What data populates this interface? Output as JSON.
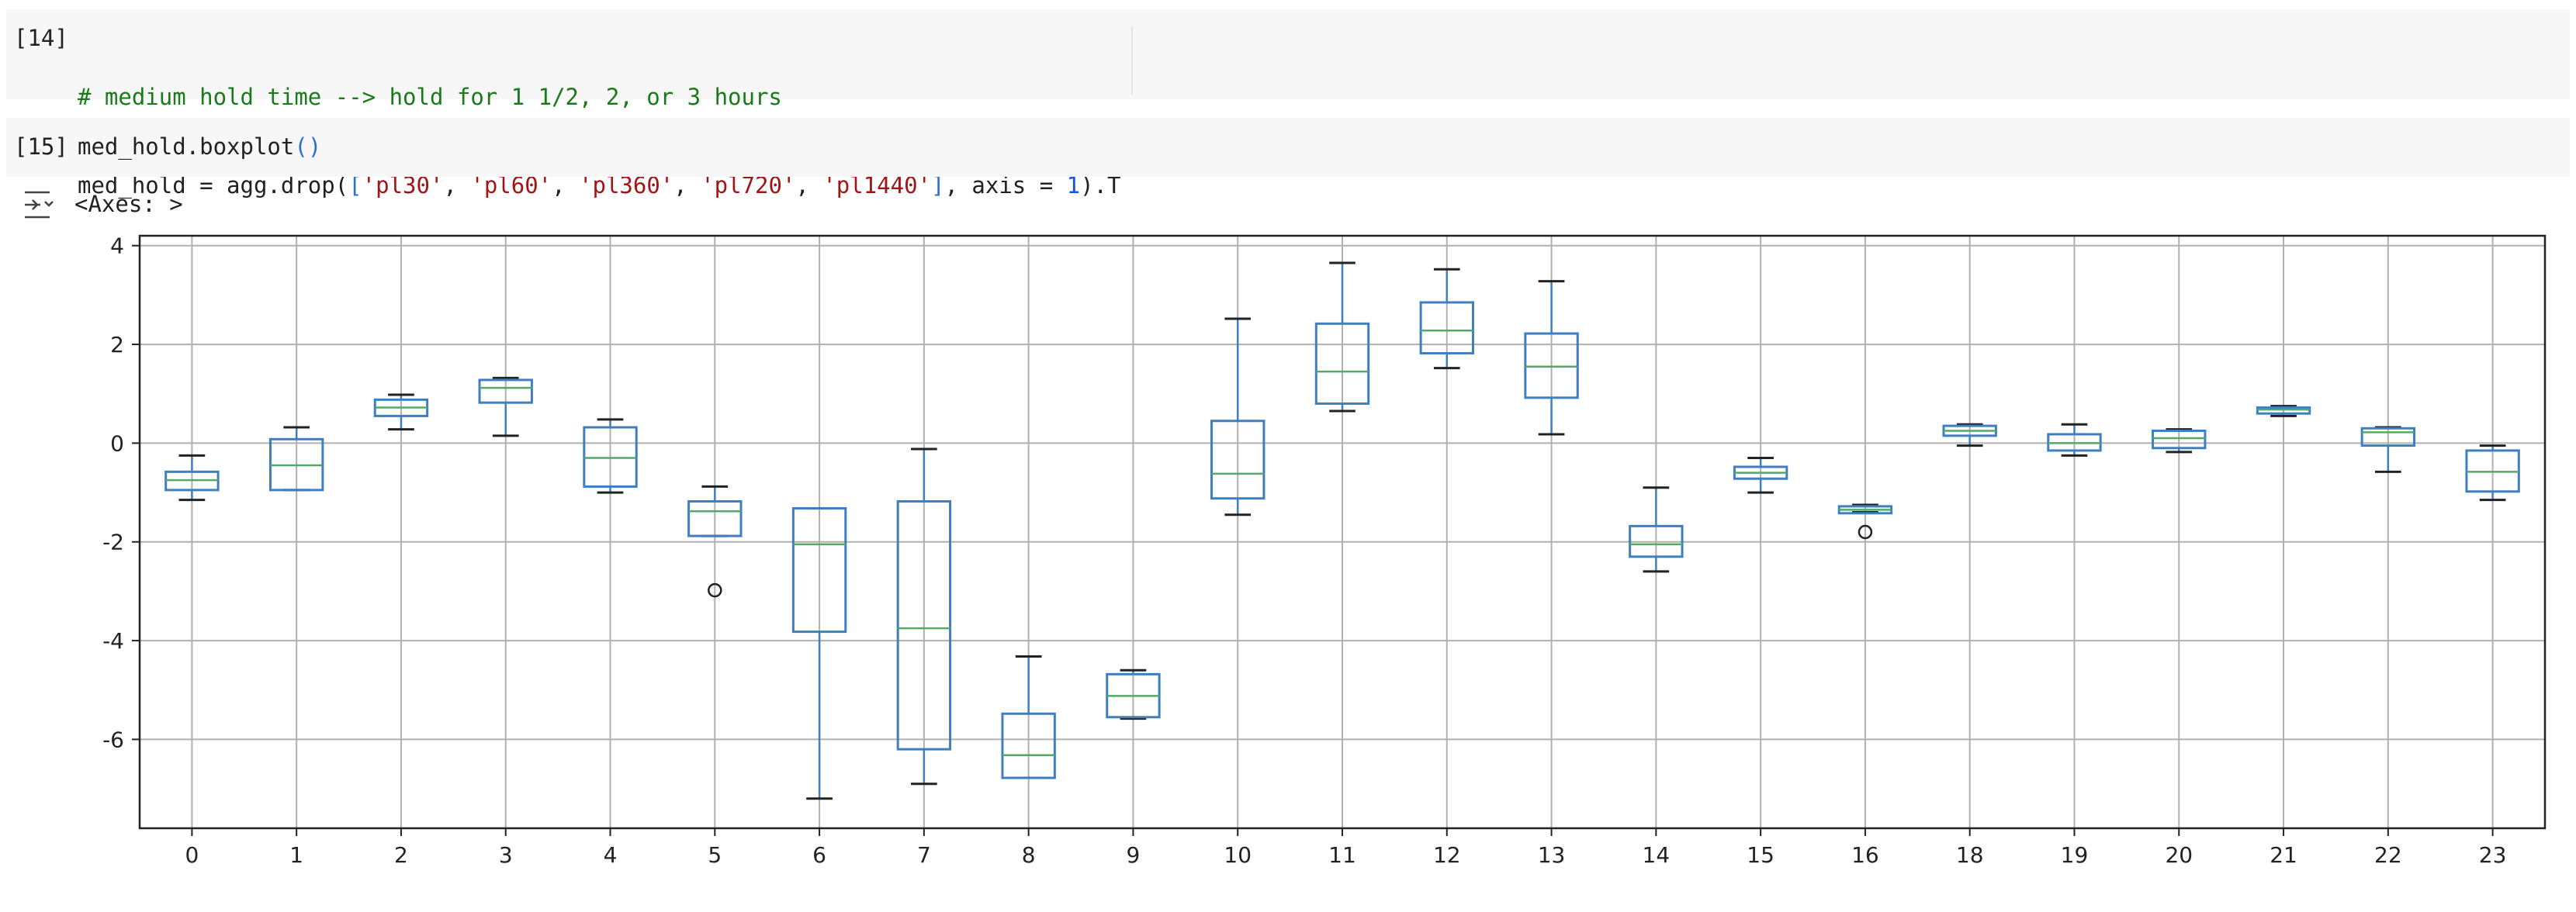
{
  "cells": [
    {
      "prompt": "[14]",
      "line1_comment": "# medium hold time --> hold for 1 1/2, 2, or 3 hours",
      "line2": {
        "pre": "med_hold = agg.drop(",
        "bracket_open": "[",
        "s1": "'pl30'",
        "c1": ", ",
        "s2": "'pl60'",
        "c2": ", ",
        "s3": "'pl360'",
        "c3": ", ",
        "s4": "'pl720'",
        "c4": ", ",
        "s5": "'pl1440'",
        "bracket_close": "]",
        "mid": ", axis = ",
        "num": "1",
        "post": ").T"
      }
    },
    {
      "prompt": "[15]",
      "code": "med_hold.boxplot",
      "parens": "()"
    }
  ],
  "output": {
    "toggle_icon": "output-collapse-icon",
    "repr": "<Axes: >"
  },
  "colors": {
    "box": "#3f7fbf",
    "median": "#55a868",
    "whisker": "#222222",
    "grid": "#b0b0b0"
  },
  "chart_data": {
    "type": "boxplot",
    "grid": true,
    "ylim": [
      -7.8,
      4.2
    ],
    "yticks": [
      -6,
      -4,
      -2,
      0,
      2,
      4
    ],
    "categories": [
      "0",
      "1",
      "2",
      "3",
      "4",
      "5",
      "6",
      "7",
      "8",
      "9",
      "10",
      "11",
      "12",
      "13",
      "14",
      "15",
      "16",
      "18",
      "19",
      "20",
      "21",
      "22",
      "23"
    ],
    "boxes": [
      {
        "label": "0",
        "whislo": -1.15,
        "q1": -0.95,
        "med": -0.75,
        "q3": -0.58,
        "whishi": -0.25,
        "fliers": []
      },
      {
        "label": "1",
        "whislo": -0.95,
        "q1": -0.95,
        "med": -0.45,
        "q3": 0.08,
        "whishi": 0.32,
        "fliers": []
      },
      {
        "label": "2",
        "whislo": 0.28,
        "q1": 0.55,
        "med": 0.72,
        "q3": 0.88,
        "whishi": 0.98,
        "fliers": []
      },
      {
        "label": "3",
        "whislo": 0.15,
        "q1": 0.82,
        "med": 1.12,
        "q3": 1.28,
        "whishi": 1.32,
        "fliers": []
      },
      {
        "label": "4",
        "whislo": -1.0,
        "q1": -0.88,
        "med": -0.3,
        "q3": 0.32,
        "whishi": 0.48,
        "fliers": []
      },
      {
        "label": "5",
        "whislo": -1.88,
        "q1": -1.88,
        "med": -1.38,
        "q3": -1.18,
        "whishi": -0.88,
        "fliers": [
          -2.98
        ]
      },
      {
        "label": "6",
        "whislo": -7.2,
        "q1": -3.82,
        "med": -2.05,
        "q3": -1.32,
        "whishi": -1.32,
        "fliers": []
      },
      {
        "label": "7",
        "whislo": -6.9,
        "q1": -6.2,
        "med": -3.75,
        "q3": -1.18,
        "whishi": -0.12,
        "fliers": []
      },
      {
        "label": "8",
        "whislo": -6.78,
        "q1": -6.78,
        "med": -6.32,
        "q3": -5.48,
        "whishi": -4.32,
        "fliers": []
      },
      {
        "label": "9",
        "whislo": -5.58,
        "q1": -5.55,
        "med": -5.12,
        "q3": -4.68,
        "whishi": -4.6,
        "fliers": []
      },
      {
        "label": "10",
        "whislo": -1.45,
        "q1": -1.12,
        "med": -0.62,
        "q3": 0.45,
        "whishi": 2.52,
        "fliers": []
      },
      {
        "label": "11",
        "whislo": 0.65,
        "q1": 0.8,
        "med": 1.45,
        "q3": 2.42,
        "whishi": 3.65,
        "fliers": []
      },
      {
        "label": "12",
        "whislo": 1.52,
        "q1": 1.82,
        "med": 2.28,
        "q3": 2.85,
        "whishi": 3.52,
        "fliers": []
      },
      {
        "label": "13",
        "whislo": 0.18,
        "q1": 0.92,
        "med": 1.55,
        "q3": 2.22,
        "whishi": 3.28,
        "fliers": []
      },
      {
        "label": "14",
        "whislo": -2.6,
        "q1": -2.3,
        "med": -2.05,
        "q3": -1.68,
        "whishi": -0.9,
        "fliers": []
      },
      {
        "label": "15",
        "whislo": -1.0,
        "q1": -0.72,
        "med": -0.6,
        "q3": -0.48,
        "whishi": -0.3,
        "fliers": []
      },
      {
        "label": "16",
        "whislo": -1.4,
        "q1": -1.42,
        "med": -1.35,
        "q3": -1.28,
        "whishi": -1.25,
        "fliers": [
          -1.8
        ]
      },
      {
        "label": "18",
        "whislo": -0.05,
        "q1": 0.15,
        "med": 0.25,
        "q3": 0.35,
        "whishi": 0.38,
        "fliers": []
      },
      {
        "label": "19",
        "whislo": -0.25,
        "q1": -0.15,
        "med": 0.0,
        "q3": 0.18,
        "whishi": 0.38,
        "fliers": []
      },
      {
        "label": "20",
        "whislo": -0.18,
        "q1": -0.1,
        "med": 0.1,
        "q3": 0.25,
        "whishi": 0.28,
        "fliers": []
      },
      {
        "label": "21",
        "whislo": 0.55,
        "q1": 0.6,
        "med": 0.68,
        "q3": 0.72,
        "whishi": 0.75,
        "fliers": []
      },
      {
        "label": "22",
        "whislo": -0.58,
        "q1": -0.05,
        "med": 0.22,
        "q3": 0.3,
        "whishi": 0.32,
        "fliers": []
      },
      {
        "label": "23",
        "whislo": -1.15,
        "q1": -0.98,
        "med": -0.58,
        "q3": -0.15,
        "whishi": -0.05,
        "fliers": []
      }
    ]
  }
}
